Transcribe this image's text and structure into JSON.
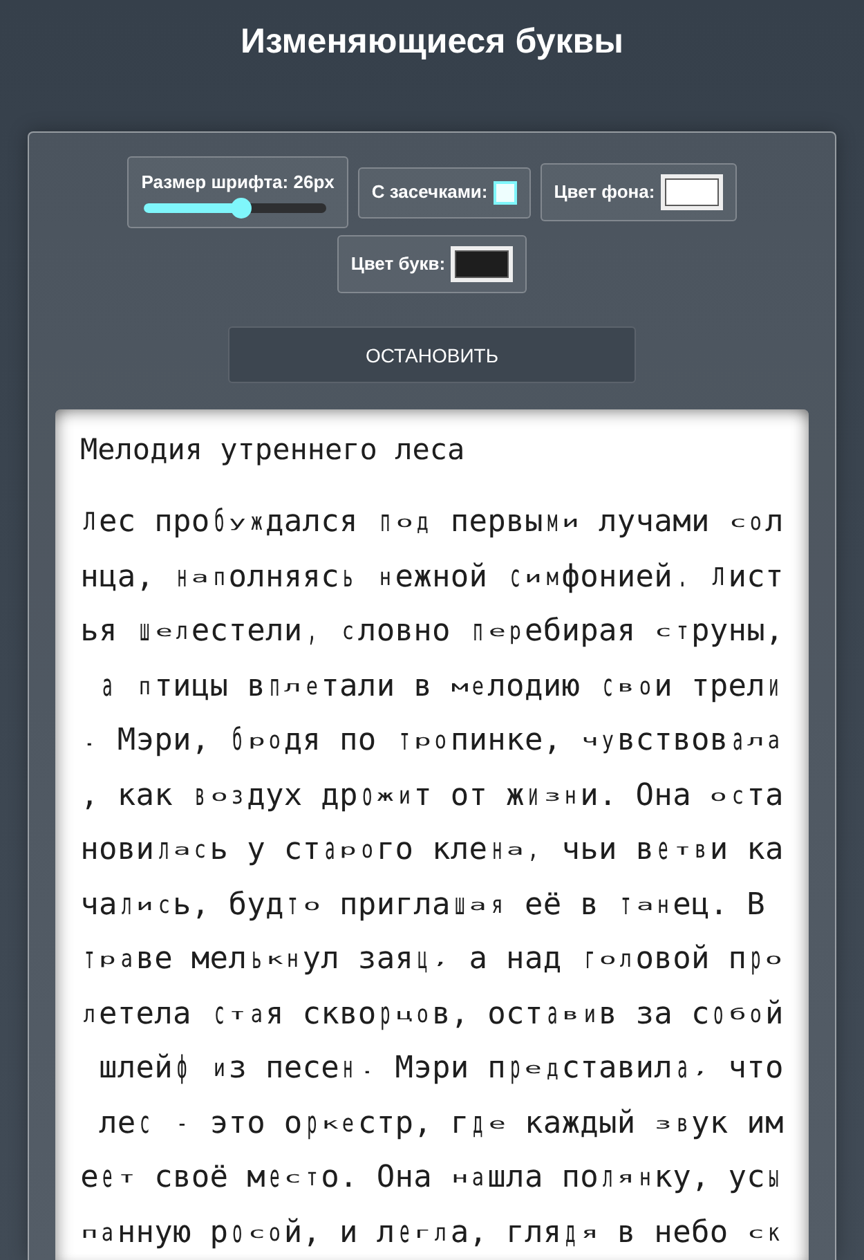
{
  "page": {
    "title": "Изменяющиеся буквы"
  },
  "controls": [
    {
      "kind": "slider",
      "label": "Размер шрифта: 26px",
      "level": 0.53
    },
    {
      "kind": "checkbox",
      "label": "С засечками:",
      "checked": false
    },
    {
      "kind": "color",
      "label": "Цвет фона:",
      "color": "#ffffff"
    },
    {
      "kind": "color",
      "label": "Цвет букв:",
      "color": "#1e1e1e"
    }
  ],
  "stop_button": {
    "label": "ОСТАНОВИТЬ"
  },
  "document": {
    "title": "Мелодия утреннего леса",
    "text": "Лес пробуждался под первыми лучами солнца, наполняясь нежной симфонией. Листья шелестели, словно перебирая струны, а птицы вплетали в мелодию свои трели. Мэри, бродя по тропинке, чувствовала, как воздух дрожит от жизни. Она остановилась у старого клена, чьи ветви качались, будто приглашая её в танец. В траве мелькнул заяц, а над головой пролетела стая скворцов, оставив за собой шлейф из песен. Мэри представила, что лес - это оркестр, где каждый звук имеет своё место. Она нашла полянку, усыпанную росой, и легла, глядя в небо ск"
  }
}
